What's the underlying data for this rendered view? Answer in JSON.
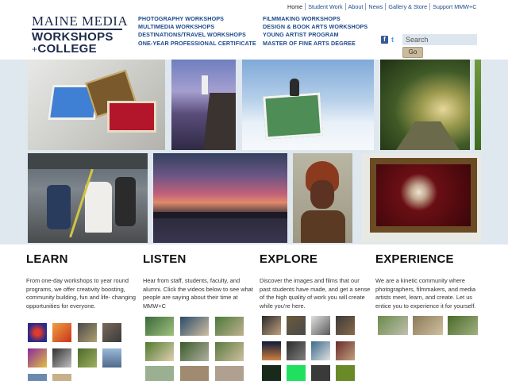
{
  "logo": {
    "line1": "MAINE MEDIA",
    "line2": "WORKSHOPS",
    "line3_plus": "+",
    "line3": "COLLEGE"
  },
  "top_nav": [
    "Home",
    "Student Work",
    "About",
    "News",
    "Gallery & Store",
    "Support MMW+C"
  ],
  "nav_col1": [
    "PHOTOGRAPHY WORKSHOPS",
    "MULTIMEDIA WORKSHOPS",
    "DESTINATIONS/TRAVEL WORKSHOPS",
    "ONE-YEAR PROFESSIONAL CERTIFICATE"
  ],
  "nav_col2": [
    "FILMMAKING WORKSHOPS",
    "DESIGN & BOOK ARTS WORKSHOPS",
    "YOUNG ARTIST PROGRAM",
    "MASTER OF FINE ARTS DEGREE"
  ],
  "search": {
    "placeholder": "Search",
    "go_label": "Go"
  },
  "icons": {
    "facebook": "facebook-icon",
    "twitter": "twitter-icon"
  },
  "sections": [
    {
      "title": "LEARN",
      "text": "From one-day workshops to year round programs, we offer creativity boosting, community building, fun and life- changing opportunities for everyone."
    },
    {
      "title": "LISTEN",
      "text": "Hear from staff, students, faculty, and alumni. Click the videos below to see what people are saying about their time at MMW+C"
    },
    {
      "title": "EXPLORE",
      "text": "Discover the images and films that our past students have made, and get a sense of the high quality of work you will create while you're here."
    },
    {
      "title": "EXPERIENCE",
      "text": "We are a kinetic community where photographers, filmmakers, and media artists meet, learn, and create. Let us entice you to experience it for yourself."
    }
  ],
  "colors": {
    "brand_navy": "#1b2a4a",
    "link_blue": "#1c4a8a",
    "mosaic_bg": "#dfe7ef",
    "go_button": "#c9ba9b"
  }
}
